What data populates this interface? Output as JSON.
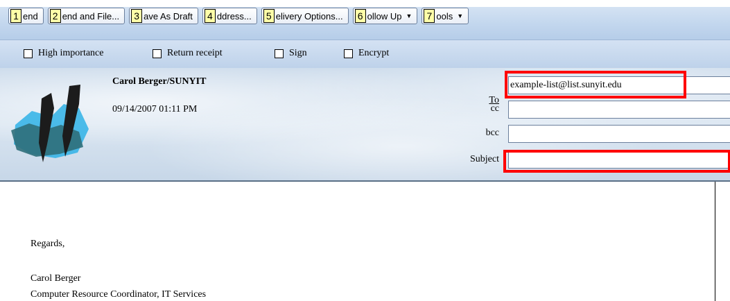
{
  "toolbar": {
    "buttons": [
      {
        "key": "1",
        "label": "end",
        "dropdown": false
      },
      {
        "key": "2",
        "label": "end and File...",
        "dropdown": false
      },
      {
        "key": "3",
        "label": "ave As Draft",
        "dropdown": false
      },
      {
        "key": "4",
        "label": "ddress...",
        "dropdown": false
      },
      {
        "key": "5",
        "label": "elivery Options...",
        "dropdown": false
      },
      {
        "key": "6",
        "label": "ollow Up",
        "dropdown": true
      },
      {
        "key": "7",
        "label": "ools",
        "dropdown": true
      }
    ]
  },
  "options": {
    "high_importance": "High importance",
    "return_receipt": "Return receipt",
    "sign": "Sign",
    "encrypt": "Encrypt"
  },
  "header": {
    "sender": "Carol Berger/SUNYIT",
    "date": "09/14/2007 01:11 PM",
    "to_label": "To",
    "to_value": "example-list@list.sunyit.edu",
    "cc_label": "cc",
    "cc_value": "",
    "bcc_label": "bcc",
    "bcc_value": "",
    "subject_label": "Subject",
    "subject_value": ""
  },
  "body": {
    "regards": "Regards,",
    "name": "Carol Berger",
    "title": "Computer Resource Coordinator, IT Services"
  },
  "colors": {
    "highlight": "#ff0000",
    "hotkey_bg": "#ffffa8",
    "toolbar": "#c3d7ee"
  },
  "icons": {
    "logo": "sunyit-logo",
    "dropdown": "chevron-down-icon"
  }
}
